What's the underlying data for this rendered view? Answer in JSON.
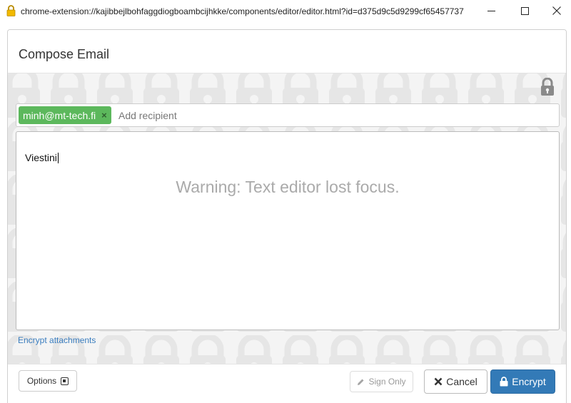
{
  "window": {
    "title": "chrome-extension://kajibbejlbohfaggdiogboambcijhkke/components/editor/editor.html?id=d375d9c5d9299cf65457737"
  },
  "dialog": {
    "title": "Compose Email"
  },
  "recipients": {
    "tags": [
      "minh@mt-tech.fi"
    ],
    "remove_label": "×",
    "placeholder": "Add recipient",
    "value": ""
  },
  "editor": {
    "text": "Viestini",
    "warning": "Warning: Text editor lost focus."
  },
  "attachments": {
    "link_label": "Encrypt attachments"
  },
  "footer": {
    "options_label": "Options",
    "sign_label": "Sign Only",
    "cancel_label": "Cancel",
    "encrypt_label": "Encrypt"
  },
  "colors": {
    "tag_green": "#5cb85c",
    "primary_blue": "#337ab7",
    "link_blue": "#3a7dbf",
    "warning_gray": "#aaaaaa"
  },
  "icons": {
    "title_lock": "padlock-icon",
    "lock_toggle": "lock-icon",
    "sign": "pencil-icon",
    "cancel": "x-icon",
    "encrypt": "lock-icon"
  }
}
